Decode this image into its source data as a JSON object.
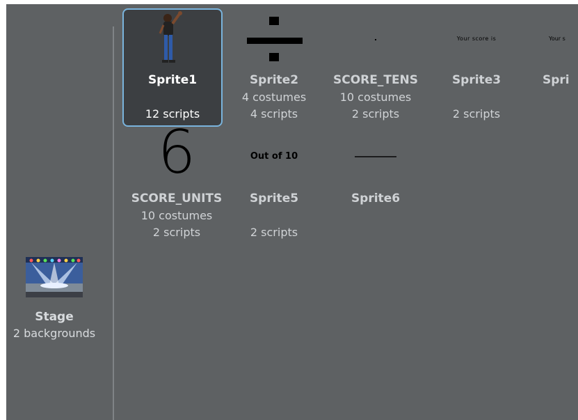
{
  "stage": {
    "name": "Stage",
    "info": "2 backgrounds"
  },
  "sprites": [
    {
      "name": "Sprite1",
      "costumes": "",
      "scripts": "12 scripts"
    },
    {
      "name": "Sprite2",
      "costumes": "4 costumes",
      "scripts": "4 scripts"
    },
    {
      "name": "SCORE_TENS",
      "costumes": "10 costumes",
      "scripts": "2 scripts"
    },
    {
      "name": "Sprite3",
      "costumes": "",
      "scripts": "2 scripts"
    },
    {
      "name": "Spri",
      "costumes": "",
      "scripts": ""
    },
    {
      "name": "SCORE_UNITS",
      "costumes": "10 costumes",
      "scripts": "2 scripts"
    },
    {
      "name": "Sprite5",
      "costumes": "",
      "scripts": "2 scripts"
    },
    {
      "name": "Sprite6",
      "costumes": "",
      "scripts": ""
    }
  ],
  "thumb_text": {
    "score_units_digit": "6",
    "sprite5_text": "Out of 10",
    "sprite3_text": "Your score is",
    "sprite4_text": "Your s"
  }
}
